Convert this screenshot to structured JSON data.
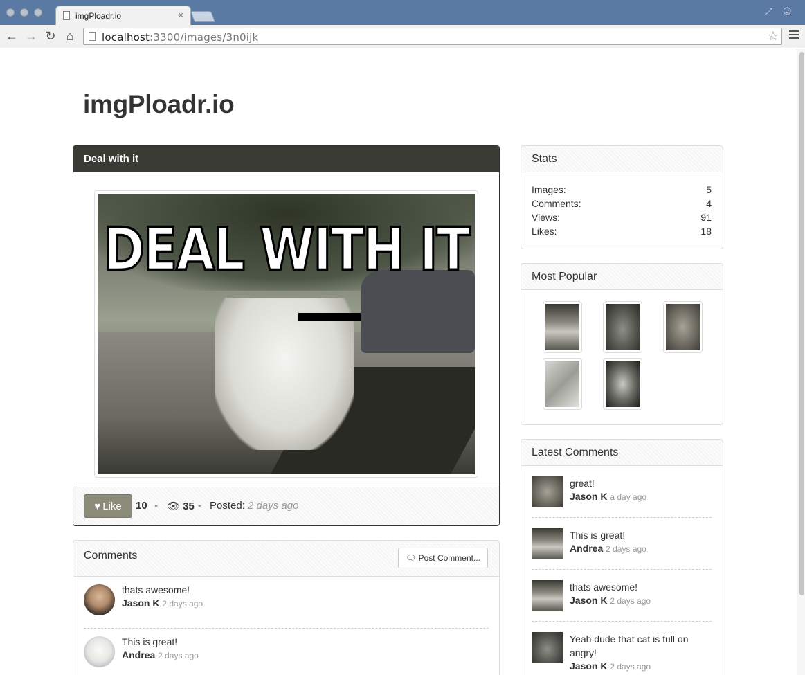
{
  "browser": {
    "tab_title": "imgPloadr.io",
    "tab_close": "×",
    "url_host": "localhost",
    "url_path": ":3300/images/3n0ijk"
  },
  "site": {
    "title": "imgPloadr.io"
  },
  "image": {
    "title": "Deal with it",
    "meme_text": "DEAL WITH IT",
    "like_label": "Like",
    "likes": "10",
    "separator": "-",
    "views": "35",
    "posted_label": "Posted:",
    "posted_time": "2 days ago"
  },
  "comments": {
    "heading": "Comments",
    "post_button": "Post Comment...",
    "items": [
      {
        "text": "thats awesome!",
        "author": "Jason K",
        "time": "2 days ago"
      },
      {
        "text": "This is great!",
        "author": "Andrea",
        "time": "2 days ago"
      }
    ]
  },
  "stats": {
    "heading": "Stats",
    "rows": [
      {
        "label": "Images:",
        "value": "5"
      },
      {
        "label": "Comments:",
        "value": "4"
      },
      {
        "label": "Views:",
        "value": "91"
      },
      {
        "label": "Likes:",
        "value": "18"
      }
    ]
  },
  "popular": {
    "heading": "Most Popular"
  },
  "latest": {
    "heading": "Latest Comments",
    "items": [
      {
        "text": "great!",
        "author": "Jason K",
        "time": "a day ago"
      },
      {
        "text": "This is great!",
        "author": "Andrea",
        "time": "2 days ago"
      },
      {
        "text": "thats awesome!",
        "author": "Jason K",
        "time": "2 days ago"
      },
      {
        "text": "Yeah dude that cat is full on angry!",
        "author": "Jason K",
        "time": "2 days ago"
      }
    ]
  },
  "colors": {
    "panel_dark": "#3b3b36",
    "like_button": "#8b8b7a",
    "chrome_frame": "#5b7aa3"
  }
}
